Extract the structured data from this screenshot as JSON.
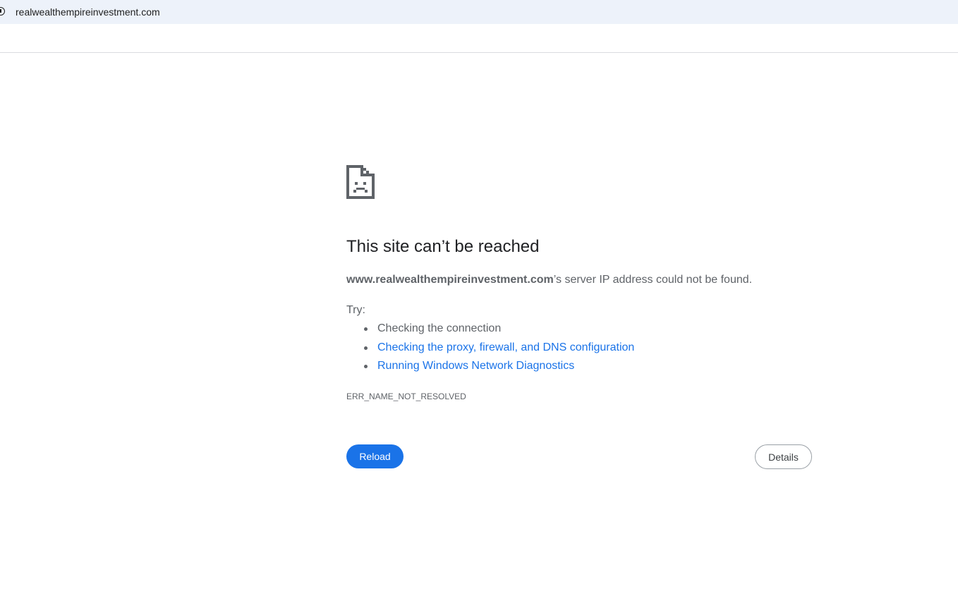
{
  "address_bar": {
    "url": "realwealthempireinvestment.com",
    "icon": "info-icon"
  },
  "error_page": {
    "icon": "sad-document-icon",
    "heading": "This site can’t be reached",
    "domain": "www.realwealthempireinvestment.com",
    "message_suffix": "’s server IP address could not be found.",
    "try_label": "Try:",
    "suggestions": [
      {
        "label": "Checking the connection",
        "is_link": false
      },
      {
        "label": "Checking the proxy, firewall, and DNS configuration",
        "is_link": true
      },
      {
        "label": "Running Windows Network Diagnostics",
        "is_link": true
      }
    ],
    "error_code": "ERR_NAME_NOT_RESOLVED",
    "reload_label": "Reload",
    "details_label": "Details"
  },
  "colors": {
    "accent": "#1a73e8",
    "address_bar_bg": "#edf2fa",
    "text_secondary": "#5f6368",
    "heading": "#202124"
  }
}
